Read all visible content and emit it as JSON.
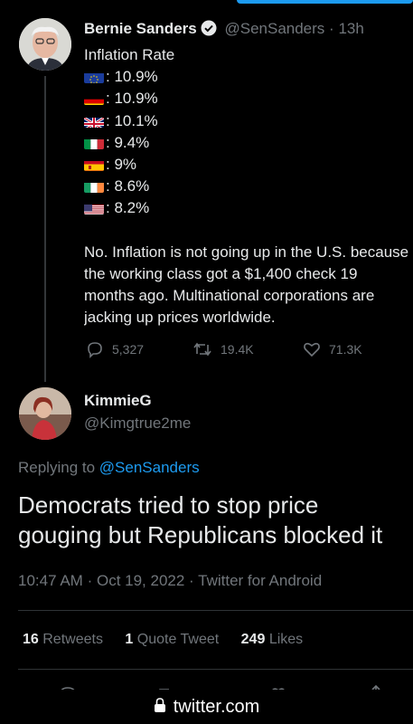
{
  "tweet": {
    "author_name": "Bernie Sanders",
    "handle": "@SenSanders",
    "separator": "·",
    "time": "13h",
    "heading": "Inflation Rate",
    "rates": [
      {
        "flag": "eu-flag-icon",
        "value": ": 10.9%"
      },
      {
        "flag": "germany-flag-icon",
        "value": ": 10.9%"
      },
      {
        "flag": "uk-flag-icon",
        "value": ": 10.1%"
      },
      {
        "flag": "italy-flag-icon",
        "value": ": 9.4%"
      },
      {
        "flag": "spain-flag-icon",
        "value": ": 9%"
      },
      {
        "flag": "ireland-flag-icon",
        "value": ": 8.6%"
      },
      {
        "flag": "us-flag-icon",
        "value": ": 8.2%"
      }
    ],
    "paragraph_lines": [
      "No. Inflation is not going up in the U.S. because",
      "the working class got a $1,400 check 19",
      "months ago. Multinational corporations are",
      "jacking up prices worldwide."
    ],
    "actions": {
      "replies": "5,327",
      "retweets": "19.4K",
      "likes": "71.3K"
    }
  },
  "reply": {
    "author_name": "KimmieG",
    "handle": "@Kimgtrue2me",
    "replying_prefix": "Replying to",
    "replying_to": "@SenSanders",
    "text_lines": [
      "Democrats tried to stop price",
      "gouging but Republicans blocked it"
    ],
    "time": "10:47 AM",
    "date": "Oct 19, 2022",
    "separator": "·",
    "source": "Twitter for Android",
    "stats": {
      "retweets_count": "16",
      "retweets_label": "Retweets",
      "quotes_count": "1",
      "quotes_label": "Quote Tweet",
      "likes_count": "249",
      "likes_label": "Likes"
    }
  },
  "browser": {
    "url": "twitter.com"
  },
  "colors": {
    "accent": "#1d9bf0",
    "background": "#000000",
    "muted": "#71767b",
    "text": "#e7e9ea"
  }
}
